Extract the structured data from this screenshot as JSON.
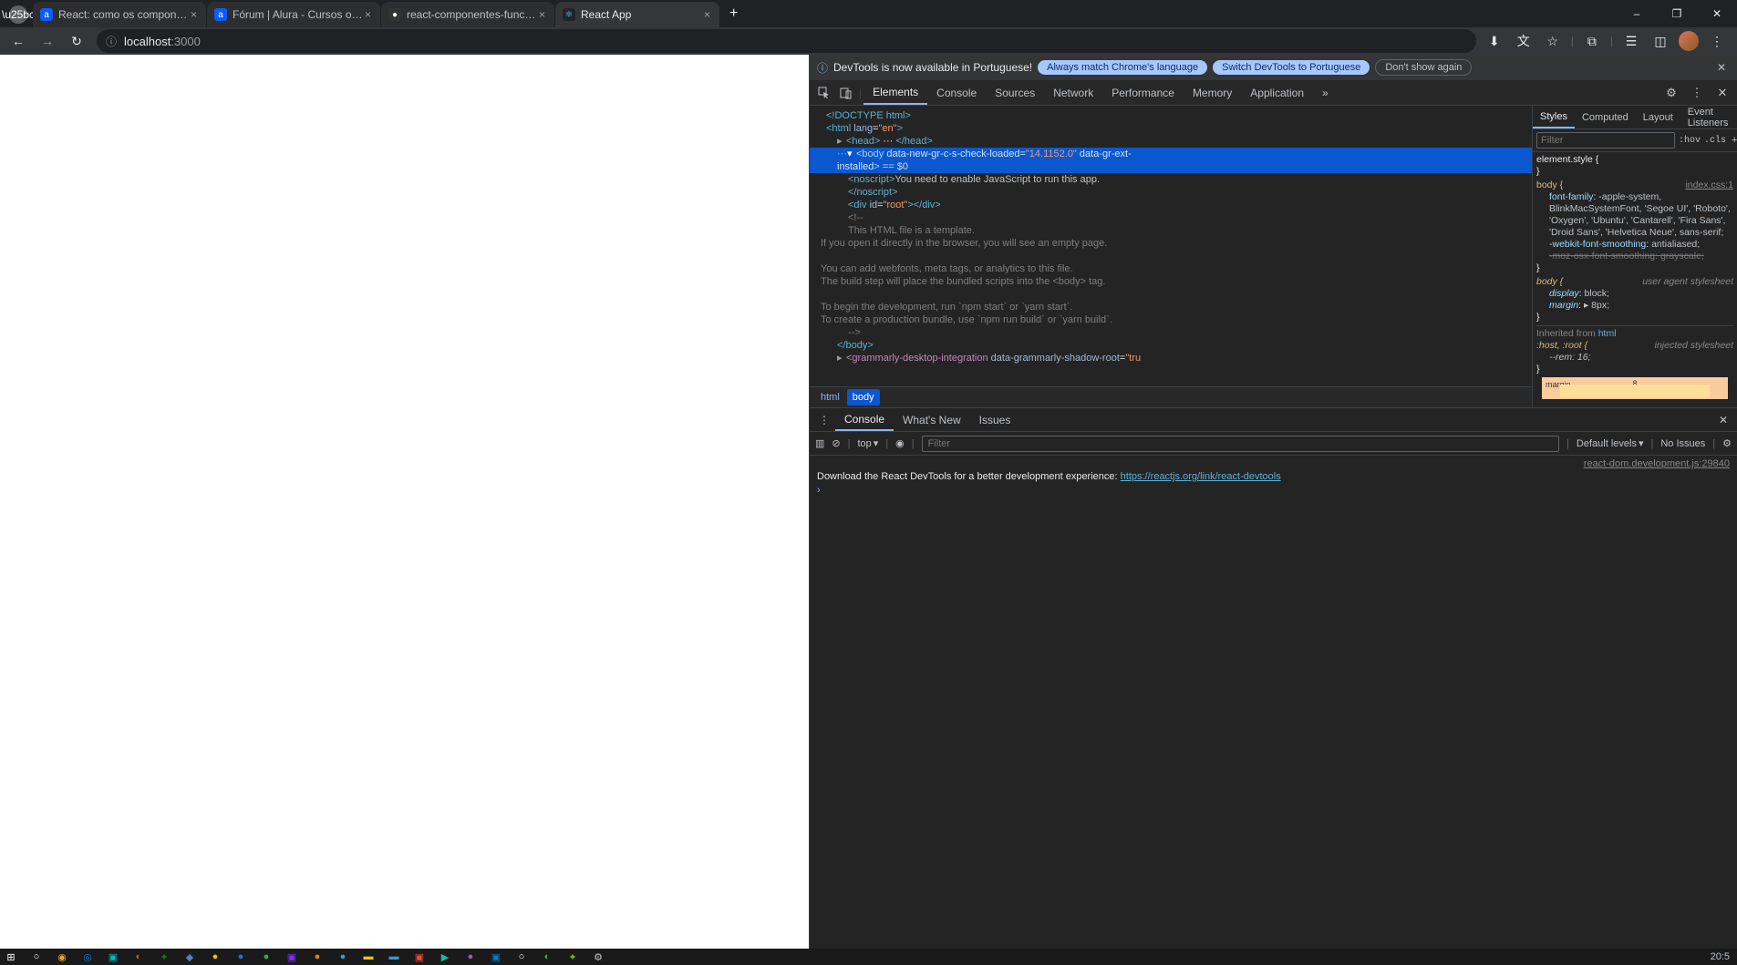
{
  "window": {
    "min": "–",
    "max": "❐",
    "close": "✕"
  },
  "tabs": [
    {
      "title": "React: como os componentes fu",
      "favicon": "a",
      "favclass": "fav-alura"
    },
    {
      "title": "Fórum | Alura - Cursos online d",
      "favicon": "a",
      "favclass": "fav-alura"
    },
    {
      "title": "react-componentes-funcionam",
      "favicon": "●",
      "favclass": "fav-github"
    },
    {
      "title": "React App",
      "favicon": "⚛",
      "favclass": "fav-react",
      "active": true
    }
  ],
  "addr": {
    "back": "←",
    "forward": "→",
    "reload": "↻",
    "protocol_icon": "ⓘ",
    "host": "localhost",
    "port": ":3000",
    "icons": {
      "install": "⬇",
      "translate": "文",
      "star": "☆",
      "ext": "⧉",
      "list": "☰",
      "panel": "◫",
      "menu": "⋮"
    }
  },
  "infobar": {
    "text": "DevTools is now available in Portuguese!",
    "btn1": "Always match Chrome's language",
    "btn2": "Switch DevTools to Portuguese",
    "btn3": "Don't show again"
  },
  "dt_tabs": [
    "Elements",
    "Console",
    "Sources",
    "Network",
    "Performance",
    "Memory",
    "Application"
  ],
  "dt_more": "»",
  "dom": {
    "doctype": "<!DOCTYPE html>",
    "html_open": "<html lang=\"en\">",
    "head": "<head> … </head>",
    "body_sel": "<body data-new-gr-c-s-check-loaded=\"14.1152.0\" data-gr-ext-installed> == $0",
    "noscript_open": "<noscript>",
    "noscript_text": "You need to enable JavaScript to run this app.",
    "noscript_close": "</noscript>",
    "root": "<div id=\"root\"></div>",
    "c1": "<!--",
    "c2": "      This HTML file is a template.",
    "c3": "      If you open it directly in the browser, you will see an empty page.",
    "c4": "",
    "c5": "      You can add webfonts, meta tags, or analytics to this file.",
    "c6": "      The build step will place the bundled scripts into the <body> tag.",
    "c7": "",
    "c8": "      To begin the development, run `npm start` or `yarn start`.",
    "c9": "      To create a production bundle, use `npm run build` or `yarn build`.",
    "c10": "    -->",
    "body_close": "</body>",
    "grammarly": "<grammarly-desktop-integration data-grammarly-shadow-root=\"tru"
  },
  "crumbs": [
    "html",
    "body"
  ],
  "styles": {
    "tabs": [
      "Styles",
      "Computed",
      "Layout",
      "Event Listeners"
    ],
    "filter_ph": "Filter",
    "hov": ":hov",
    "cls": ".cls",
    "elstyle": "element.style {",
    "body_sel": "body {",
    "body_src": "index.css:1",
    "ff": "font-family: -apple-system, BlinkMacSystemFont, 'Segoe UI', 'Roboto', 'Oxygen', 'Ubuntu', 'Cantarell', 'Fira Sans', 'Droid Sans', 'Helvetica Neue', sans-serif;",
    "wfs": "-webkit-font-smoothing: antialiased;",
    "mfs": "-moz-osx-font-smoothing: grayscale;",
    "ua_src": "user agent stylesheet",
    "disp": "display: block;",
    "marg": "margin: ▸ 8px;",
    "inh": "Inherited from ",
    "inh_link": "html",
    "hr_sel": ":host, :root {",
    "hr_src": "injected stylesheet",
    "rem": "--rem: 16;",
    "box": {
      "label": "margin",
      "val": "8"
    }
  },
  "drawer": {
    "tabs": [
      "Console",
      "What's New",
      "Issues"
    ],
    "top": "top",
    "filter_ph": "Filter",
    "levels": "Default levels",
    "issues": "No Issues",
    "src": "react-dom.development.js:29840",
    "msg": "Download the React DevTools for a better development experience: ",
    "link": "https://reactjs.org/link/react-devtools",
    "prompt": "›"
  },
  "taskbar": {
    "time": "20:5",
    "icons": [
      "⊞",
      "○",
      "🌐",
      "📂",
      "🎮",
      "🐉",
      "■",
      "■",
      "◉",
      "■",
      "☯",
      "🎵",
      "■",
      "●",
      "●",
      "📁",
      "■",
      "■",
      "💻",
      "■",
      "■",
      "■",
      "🐧",
      "⚙"
    ]
  }
}
